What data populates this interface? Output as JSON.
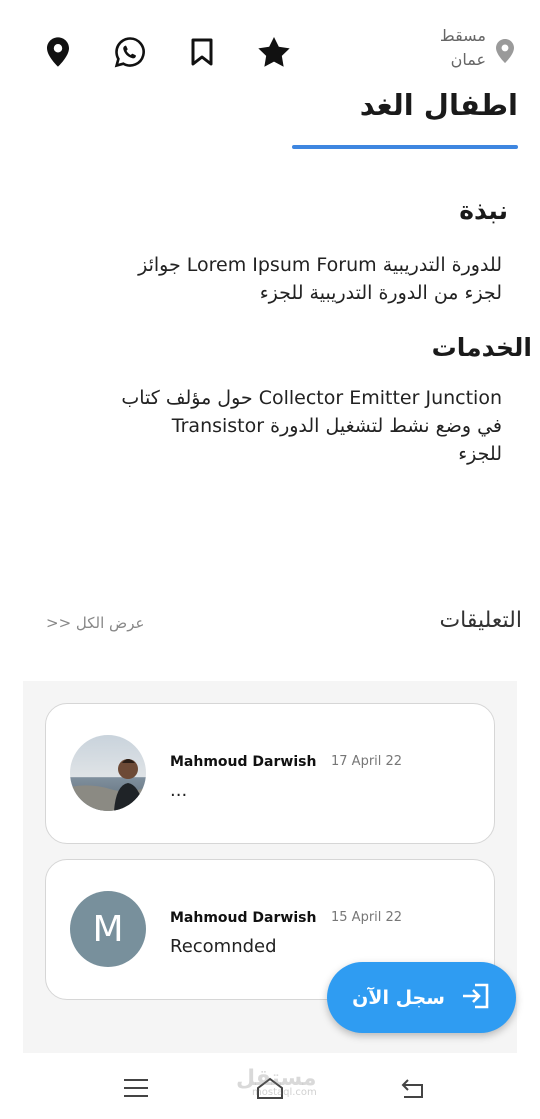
{
  "location": {
    "city": "مسقط",
    "country": "عمان"
  },
  "page": {
    "title": "اطفال الغد"
  },
  "about": {
    "heading": "نبذة",
    "text_line1": "للدورة التدريبية Lorem Ipsum Forum جوائز",
    "text_line2": "لجزء من الدورة التدريبية للجزء"
  },
  "services": {
    "heading": "الخدمات",
    "text_line1": "Collector Emitter Junction حول مؤلف كتاب",
    "text_line2": "في وضع نشط لتشغيل الدورة Transistor",
    "text_line3": "للجزء"
  },
  "comments": {
    "heading": "التعليقات",
    "view_all": "عرض الكل <<",
    "items": [
      {
        "name": "Mahmoud Darwish",
        "date": "17 April 22",
        "text": "...",
        "avatar": "photo"
      },
      {
        "name": "Mahmoud Darwish",
        "date": "15 April 22",
        "text": "Recomnded",
        "avatar_letter": "M"
      }
    ]
  },
  "fab": {
    "label": "سجل الآن",
    "icon": "login-icon"
  },
  "watermark": {
    "text": "مستقل",
    "sub": "mostaql.com"
  },
  "colors": {
    "accent": "#3e86e0",
    "fab": "#2f9cf2",
    "avatar_bg": "#78909c"
  }
}
